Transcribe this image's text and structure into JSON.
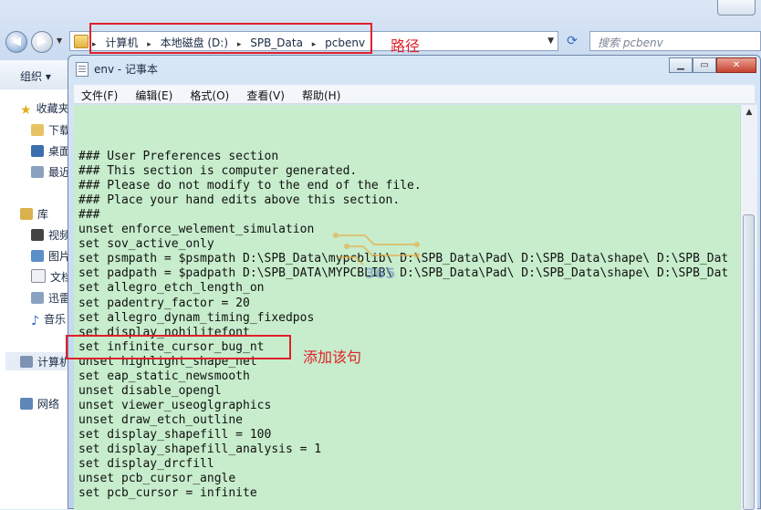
{
  "explorer": {
    "breadcrumb": [
      "计算机",
      "本地磁盘 (D:)",
      "SPB_Data",
      "pcbenv"
    ],
    "search_placeholder": "搜索 pcbenv",
    "toolbar": {
      "organize_label": "组织 ▾"
    },
    "sidebar": {
      "favorites": "收藏夹",
      "downloads": "下载",
      "desktop": "桌面",
      "recent": "最近",
      "libraries": "库",
      "videos": "视频",
      "pictures": "图片",
      "documents": "文档",
      "xunlei": "迅雷",
      "music": "音乐",
      "computer": "计算机",
      "network": "网络"
    }
  },
  "annotations": {
    "path_label": "路径",
    "add_line_label": "添加该句"
  },
  "notepad": {
    "title": "env - 记事本",
    "menu": [
      "文件(F)",
      "编辑(E)",
      "格式(O)",
      "查看(V)",
      "帮助(H)"
    ],
    "lines": [
      "### User Preferences section",
      "### This section is computer generated.",
      "### Please do not modify to the end of the file.",
      "### Place your hand edits above this section.",
      "###",
      "unset enforce_welement_simulation",
      "set sov_active_only",
      "set psmpath = $psmpath D:\\SPB_Data\\mypcblib\\ D:\\SPB_Data\\Pad\\ D:\\SPB_Data\\shape\\ D:\\SPB_Dat",
      "set padpath = $padpath D:\\SPB_DATA\\MYPCBLIB\\ D:\\SPB_Data\\Pad\\ D:\\SPB_Data\\shape\\ D:\\SPB_Dat",
      "set allegro_etch_length_on",
      "set padentry_factor = 20",
      "set allegro_dynam_timing_fixedpos",
      "set display_nohilitefont",
      "set infinite_cursor_bug_nt",
      "unset highlight_shape_net",
      "set eap_static_newsmooth",
      "unset disable_opengl",
      "unset viewer_useoglgraphics",
      "unset draw_etch_outline",
      "set display_shapefill = 100",
      "set display_shapefill_analysis = 1",
      "set display_drcfill",
      "unset pcb_cursor_angle",
      "set pcb_cursor = infinite"
    ]
  }
}
